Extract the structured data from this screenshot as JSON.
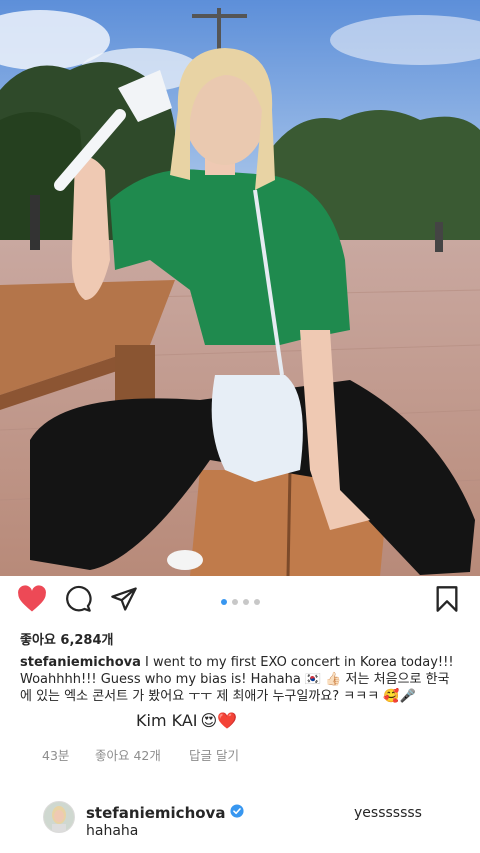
{
  "post": {
    "likes": "좋아요 6,284개",
    "caption_user": "stefaniemichova",
    "caption_text": " I went to my first EXO concert in Korea today!!! Woahhhh!!! Guess who my bias is! Hahaha 🇰🇷 👍🏻 저는 처음으로 한국에 있는 엑소 콘서트 가 봤어요 ㅜㅜ 제 최애가 누구일까요? ㅋㅋㅋ 🥰🎤",
    "highlight_line": "Kim KAI",
    "highlight_emojis": "😍❤️",
    "time": "43분",
    "comment_likes": "좋아요 42개",
    "reply_label": "답글 달기"
  },
  "comment": {
    "user": "stefaniemichova",
    "text": "hahaha",
    "reply": "yesssssss"
  },
  "carousel": {
    "count": 4,
    "active": 0
  },
  "colors": {
    "heart": "#ed4956",
    "dot_active": "#3897f0",
    "verified": "#3897f0"
  },
  "icons": [
    "heart-icon",
    "comment-icon",
    "share-icon",
    "bookmark-icon",
    "verified-icon"
  ]
}
